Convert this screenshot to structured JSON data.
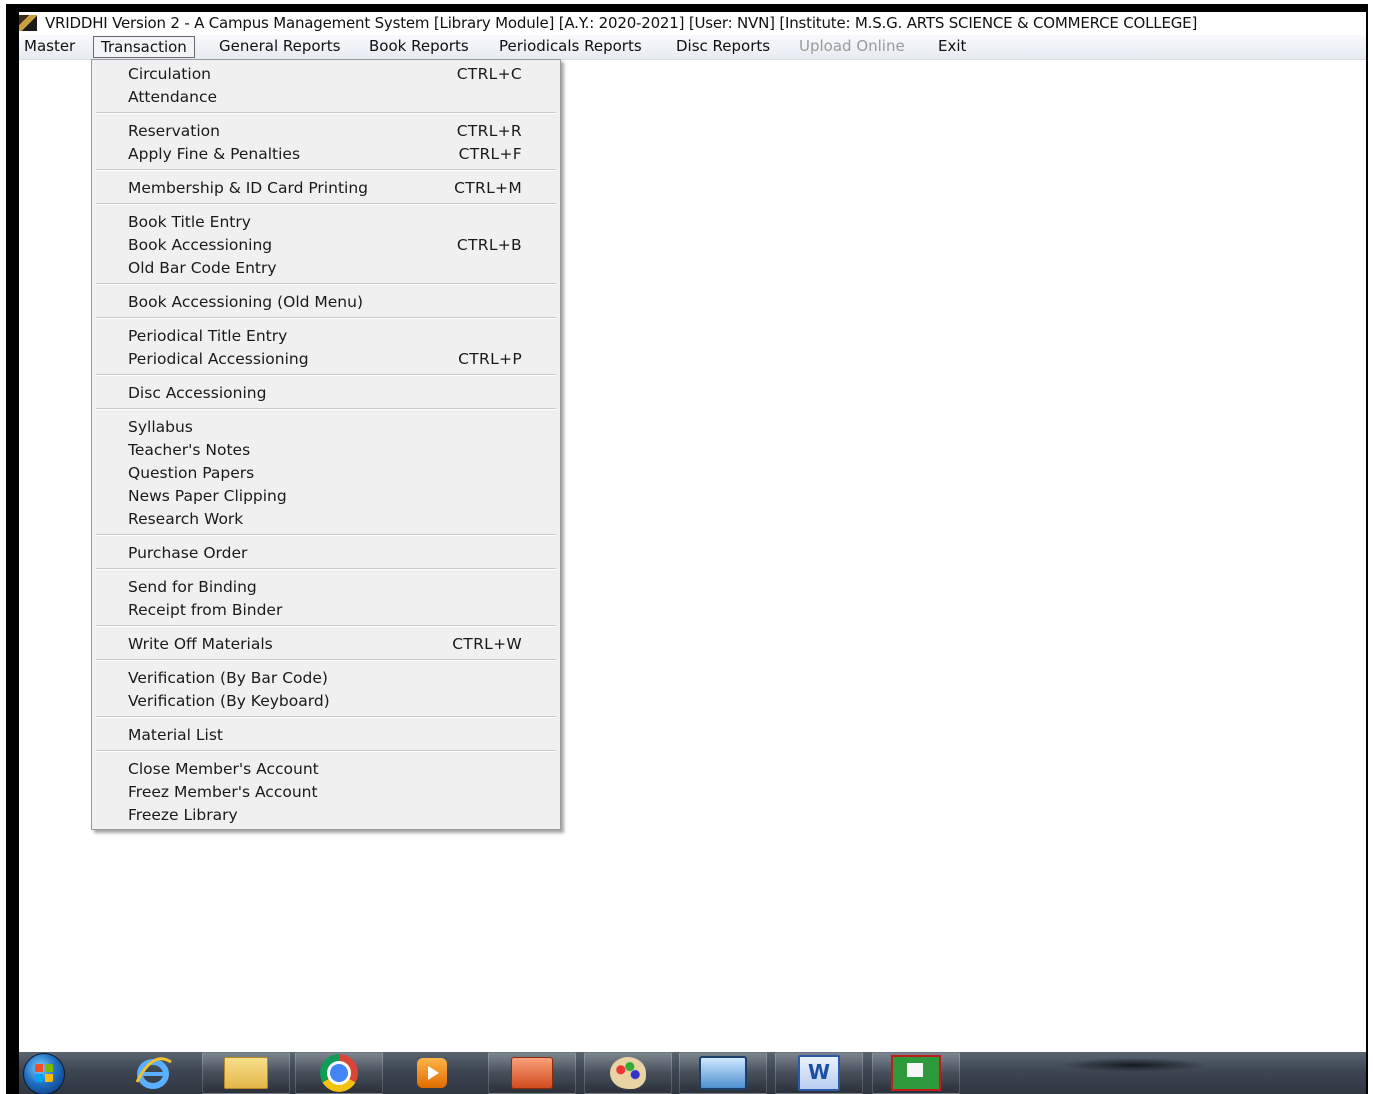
{
  "window": {
    "title": "VRIDDHI Version 2 - A Campus Management System [Library Module] [A.Y.: 2020-2021] [User: NVN] [Institute: M.S.G. ARTS SCIENCE & COMMERCE COLLEGE]"
  },
  "menubar": {
    "items": [
      {
        "label": "Master",
        "state": "normal"
      },
      {
        "label": "Transaction",
        "state": "open"
      },
      {
        "label": "General Reports",
        "state": "normal"
      },
      {
        "label": "Book Reports",
        "state": "normal"
      },
      {
        "label": "Periodicals Reports",
        "state": "normal"
      },
      {
        "label": "Disc Reports",
        "state": "normal"
      },
      {
        "label": "Upload Online",
        "state": "disabled"
      },
      {
        "label": "Exit",
        "state": "normal"
      }
    ]
  },
  "transaction_menu": {
    "items": [
      {
        "label": "Circulation",
        "shortcut": "CTRL+C"
      },
      {
        "label": "Attendance",
        "shortcut": ""
      },
      {
        "label": "Reservation",
        "shortcut": "CTRL+R"
      },
      {
        "label": "Apply Fine & Penalties",
        "shortcut": "CTRL+F"
      },
      {
        "label": "Membership & ID Card Printing",
        "shortcut": "CTRL+M"
      },
      {
        "label": "Book Title Entry",
        "shortcut": ""
      },
      {
        "label": "Book Accessioning",
        "shortcut": "CTRL+B"
      },
      {
        "label": "Old Bar Code Entry",
        "shortcut": ""
      },
      {
        "label": "Book Accessioning (Old Menu)",
        "shortcut": ""
      },
      {
        "label": "Periodical Title Entry",
        "shortcut": ""
      },
      {
        "label": "Periodical Accessioning",
        "shortcut": "CTRL+P"
      },
      {
        "label": "Disc Accessioning",
        "shortcut": ""
      },
      {
        "label": "Syllabus",
        "shortcut": ""
      },
      {
        "label": "Teacher's Notes",
        "shortcut": ""
      },
      {
        "label": "Question Papers",
        "shortcut": ""
      },
      {
        "label": "News Paper Clipping",
        "shortcut": ""
      },
      {
        "label": "Research Work",
        "shortcut": ""
      },
      {
        "label": "Purchase Order",
        "shortcut": ""
      },
      {
        "label": "Send for Binding",
        "shortcut": ""
      },
      {
        "label": "Receipt from Binder",
        "shortcut": ""
      },
      {
        "label": "Write Off Materials",
        "shortcut": "CTRL+W"
      },
      {
        "label": "Verification (By Bar Code)",
        "shortcut": ""
      },
      {
        "label": "Verification (By Keyboard)",
        "shortcut": ""
      },
      {
        "label": "Material List",
        "shortcut": ""
      },
      {
        "label": "Close Member's Account",
        "shortcut": ""
      },
      {
        "label": "Freez Member's Account",
        "shortcut": ""
      },
      {
        "label": "Freeze Library",
        "shortcut": ""
      }
    ]
  },
  "taskbar": {
    "start_icon": "windows-start-orb",
    "apps": [
      {
        "icon": "internet-explorer-icon",
        "active": false
      },
      {
        "icon": "file-explorer-icon",
        "active": true
      },
      {
        "icon": "chrome-icon",
        "active": true
      },
      {
        "icon": "media-player-icon",
        "active": false
      },
      {
        "icon": "powerpoint-icon",
        "active": true
      },
      {
        "icon": "paint-icon",
        "active": true
      },
      {
        "icon": "display-screen-icon",
        "active": true
      },
      {
        "icon": "word-icon",
        "active": true
      },
      {
        "icon": "vriddhi-app-icon",
        "active": true
      }
    ]
  }
}
